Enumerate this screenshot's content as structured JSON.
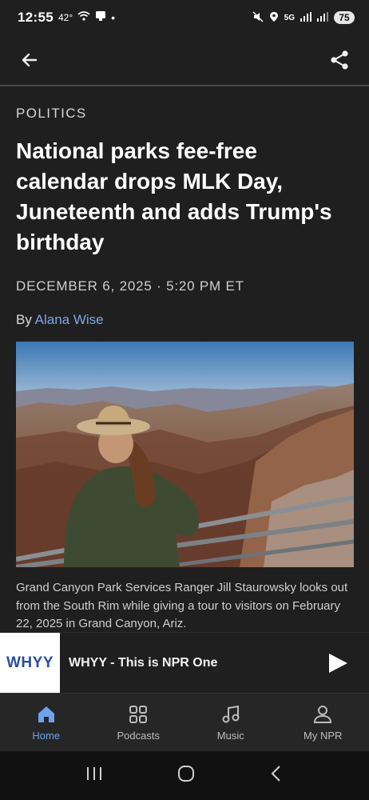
{
  "status": {
    "time": "12:55",
    "temp": "42°",
    "battery": "75",
    "network": "5G"
  },
  "article": {
    "section": "POLITICS",
    "headline": "National parks fee-free calendar drops MLK Day, Juneteenth and adds Trump's birthday",
    "dateline": "DECEMBER 6, 2025 · 5:20 PM ET",
    "by_prefix": "By ",
    "author": "Alana Wise",
    "caption": "Grand Canyon Park Services Ranger Jill Staurowsky looks out from the South Rim while giving a tour to visitors on February 22, 2025 in Grand Canyon, Ariz."
  },
  "player": {
    "station_logo_text": "WHYY",
    "title": "WHYY - This is NPR One"
  },
  "tabs": [
    {
      "label": "Home",
      "icon": "home-icon",
      "active": true
    },
    {
      "label": "Podcasts",
      "icon": "grid-icon",
      "active": false
    },
    {
      "label": "Music",
      "icon": "music-note-icon",
      "active": false
    },
    {
      "label": "My NPR",
      "icon": "person-icon",
      "active": false
    }
  ],
  "colors": {
    "background": "#1f1f1f",
    "accent": "#6ea2ec",
    "author_link": "#7ea7e6"
  }
}
